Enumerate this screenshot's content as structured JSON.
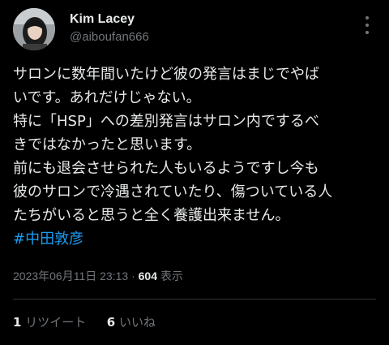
{
  "author": {
    "name": "Kim Lacey",
    "handle": "@aiboufan666"
  },
  "tweet": {
    "lines": [
      "サロンに数年間いたけど彼の発言はまじでやば",
      "いです。あれだけじゃない。",
      "特に「HSP」への差別発言はサロン内でするべ",
      "きではなかったと思います。",
      "前にも退会させられた人もいるようですし今も",
      "彼のサロンで冷遇されていたり、傷ついている人",
      "たちがいると思うと全く養護出来ません。"
    ],
    "hashtag": "#中田敦彦"
  },
  "meta": {
    "timestamp": "2023年06月11日 23:13",
    "separator": "·",
    "views_count": "604",
    "views_label": "表示"
  },
  "stats": {
    "retweets_count": "1",
    "retweets_label": "リツイート",
    "likes_count": "6",
    "likes_label": "いいね"
  },
  "icons": {
    "more": "more-options-icon",
    "avatar": "avatar"
  },
  "colors": {
    "background": "#000000",
    "text": "#e7e9ea",
    "secondary": "#71767b",
    "link": "#1d9bf0",
    "divider": "#2f3336"
  }
}
